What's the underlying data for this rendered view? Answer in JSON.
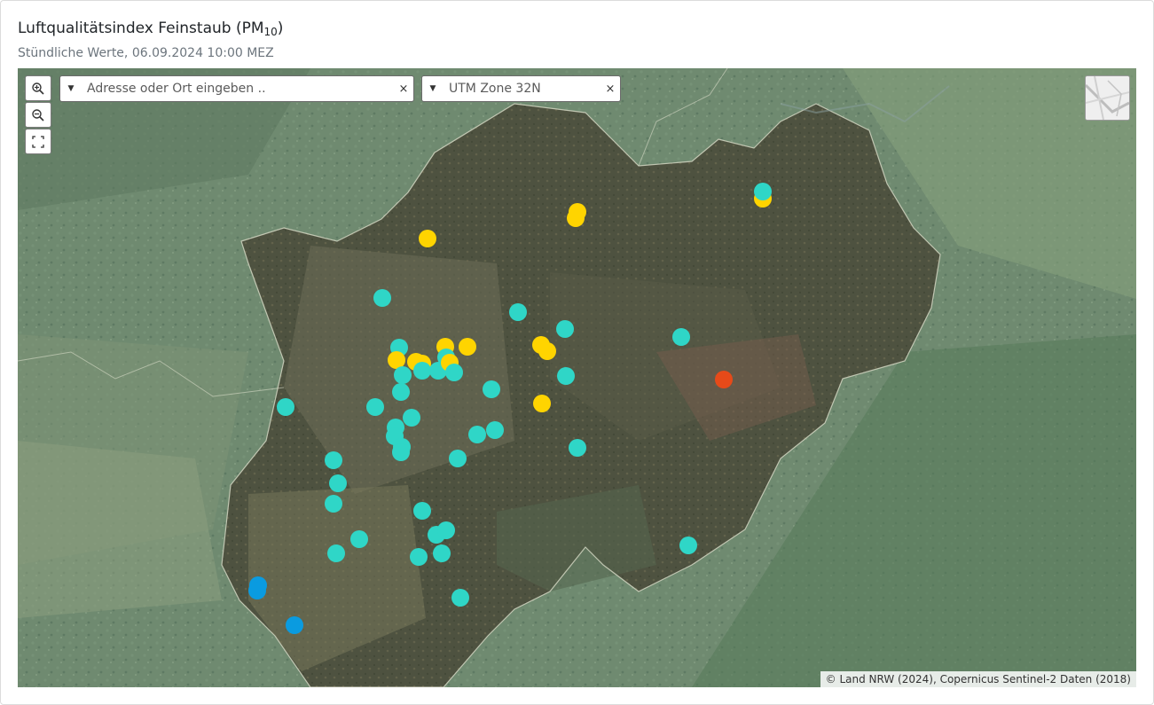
{
  "header": {
    "title_main": "Luftqualitätsindex Feinstaub (PM",
    "title_sub": "10",
    "title_end": ")",
    "subtitle": "Stündliche Werte, 06.09.2024 10:00 MEZ"
  },
  "map": {
    "address_search": {
      "placeholder": "Adresse oder Ort eingeben ..",
      "clear_label": "×"
    },
    "crs_select": {
      "value": "UTM Zone 32N",
      "clear_label": "×"
    },
    "zoom_in_icon": "zoom-in-icon",
    "zoom_out_icon": "zoom-out-icon",
    "fullscreen_icon": "fullscreen-icon",
    "basemap_icon": "basemap-toggle-icon",
    "attribution": "© Land NRW (2024), Copernicus Sentinel-2 Daten (2018)"
  },
  "colors": {
    "cyan": "#2fd6c7",
    "yellow": "#ffd400",
    "orange": "#e64a19",
    "blue": "#0a9be0"
  }
}
